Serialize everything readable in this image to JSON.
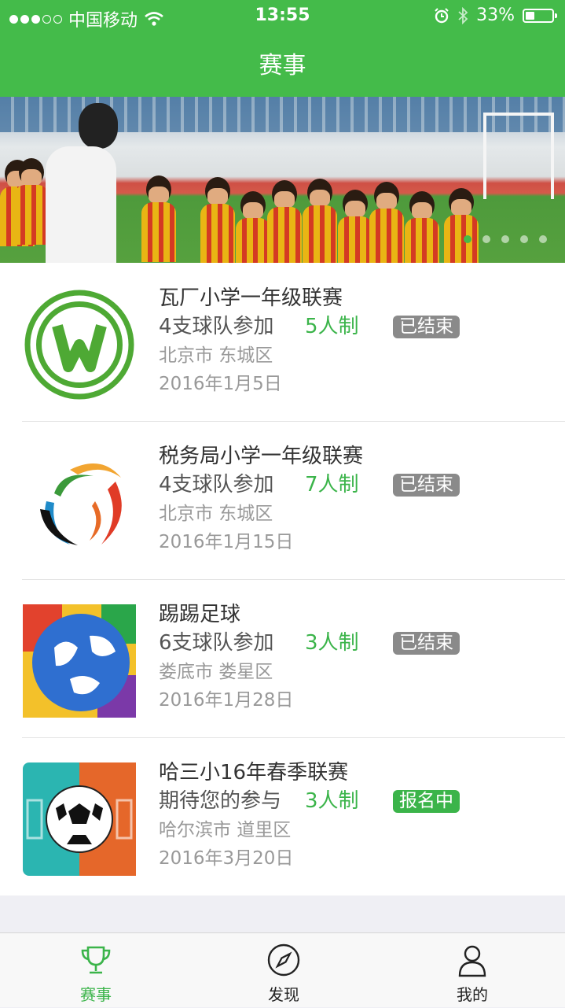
{
  "status_bar": {
    "carrier": "中国移动",
    "time": "13:55",
    "battery": "33%",
    "battery_level": 0.33
  },
  "header": {
    "title": "赛事"
  },
  "banner": {
    "pages": 5,
    "active_page": 1
  },
  "matches": [
    {
      "name": "瓦厂小学一年级联赛",
      "teams": "4支球队参加",
      "format": "5人制",
      "status": "已结束",
      "place": "北京市 东城区",
      "date": "2016年1月5日",
      "logo": "wolfsburg-logo"
    },
    {
      "name": "税务局小学一年级联赛",
      "teams": "4支球队参加",
      "format": "7人制",
      "status": "已结束",
      "place": "北京市 东城区",
      "date": "2016年1月15日",
      "logo": "swirl-logo"
    },
    {
      "name": "踢踢足球",
      "teams": "6支球队参加",
      "format": "3人制",
      "status": "已结束",
      "place": "娄底市 娄星区",
      "date": "2016年1月28日",
      "logo": "colorful-ball-logo"
    },
    {
      "name": "哈三小16年春季联赛",
      "teams": "期待您的参与",
      "format": "3人制",
      "status": "报名中",
      "place": "哈尔滨市 道里区",
      "date": "2016年3月20日",
      "logo": "soccer-ball-logo"
    }
  ],
  "tabbar": {
    "tabs": [
      {
        "label": "赛事",
        "icon": "trophy-icon",
        "active": true
      },
      {
        "label": "发现",
        "icon": "compass-icon",
        "active": false
      },
      {
        "label": "我的",
        "icon": "user-icon",
        "active": false
      }
    ]
  },
  "colors": {
    "accent": "#44bb4a",
    "ended_badge": "#8a8a8a",
    "open_badge": "#3bb44a"
  }
}
